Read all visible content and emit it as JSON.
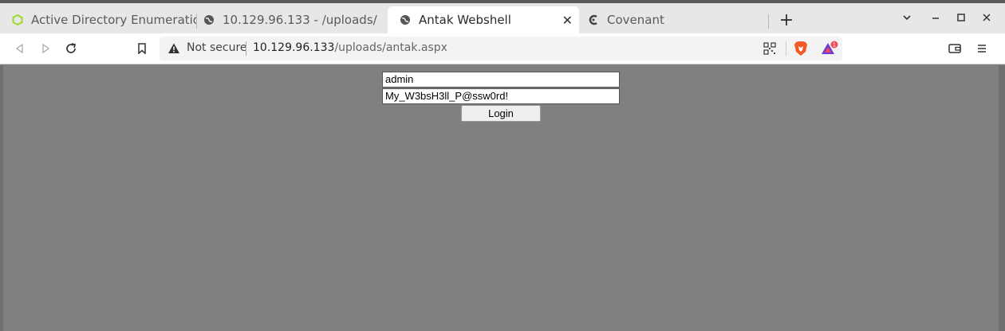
{
  "tabs": [
    {
      "label": "Active Directory Enumeration",
      "icon": "hexagon-icon",
      "active": false
    },
    {
      "label": "10.129.96.133 - /uploads/",
      "icon": "globe-icon",
      "active": false
    },
    {
      "label": "Antak Webshell",
      "icon": "globe-icon",
      "active": true
    },
    {
      "label": "Covenant",
      "icon": "covenant-icon",
      "active": false
    }
  ],
  "toolbar": {
    "security_label": "Not secure",
    "url_host": "10.129.96.133",
    "url_path": "/uploads/antak.aspx",
    "brave_badge": "1"
  },
  "form": {
    "username_value": "admin",
    "password_value": "My_W3bsH3ll_P@ssw0rd!",
    "login_label": "Login"
  }
}
